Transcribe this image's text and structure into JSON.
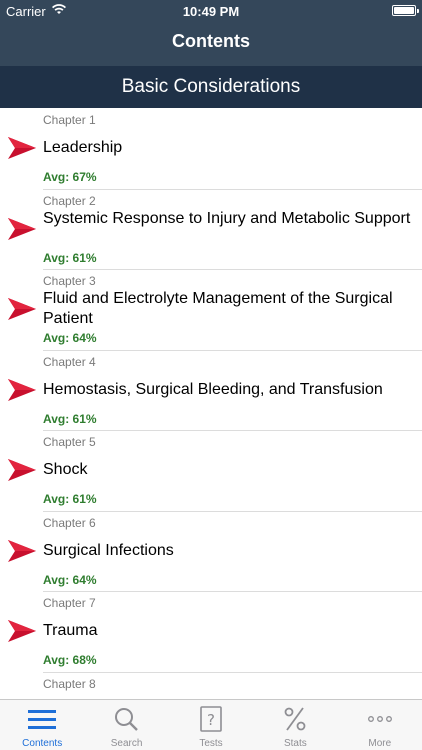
{
  "status_bar": {
    "carrier": "Carrier",
    "time": "10:49 PM"
  },
  "nav": {
    "title": "Contents"
  },
  "section": {
    "title": "Basic Considerations"
  },
  "chapters": [
    {
      "chapter": "Chapter 1",
      "title": "Leadership",
      "avg": "Avg: 67%"
    },
    {
      "chapter": "Chapter 2",
      "title": "Systemic Response to Injury and Metabolic Support",
      "avg": "Avg: 61%"
    },
    {
      "chapter": "Chapter 3",
      "title": "Fluid and Electrolyte Management of the Surgical Patient",
      "avg": "Avg: 64%"
    },
    {
      "chapter": "Chapter 4",
      "title": "Hemostasis, Surgical Bleeding, and Transfusion",
      "avg": "Avg: 61%"
    },
    {
      "chapter": "Chapter 5",
      "title": "Shock",
      "avg": "Avg: 61%"
    },
    {
      "chapter": "Chapter 6",
      "title": "Surgical Infections",
      "avg": "Avg: 64%"
    },
    {
      "chapter": "Chapter 7",
      "title": "Trauma",
      "avg": "Avg: 68%"
    },
    {
      "chapter": "Chapter 8",
      "title": "",
      "avg": ""
    }
  ],
  "tabs": [
    {
      "label": "Contents",
      "icon": "list-icon",
      "active": true
    },
    {
      "label": "Search",
      "icon": "search-icon",
      "active": false
    },
    {
      "label": "Tests",
      "icon": "question-icon",
      "active": false
    },
    {
      "label": "Stats",
      "icon": "percent-icon",
      "active": false
    },
    {
      "label": "More",
      "icon": "more-icon",
      "active": false
    }
  ],
  "colors": {
    "nav_bg": "#34475a",
    "section_bg": "#1f3147",
    "avg_text": "#2f7d2f",
    "arrow": "#c8102e",
    "active_tab": "#1e6fd8"
  }
}
